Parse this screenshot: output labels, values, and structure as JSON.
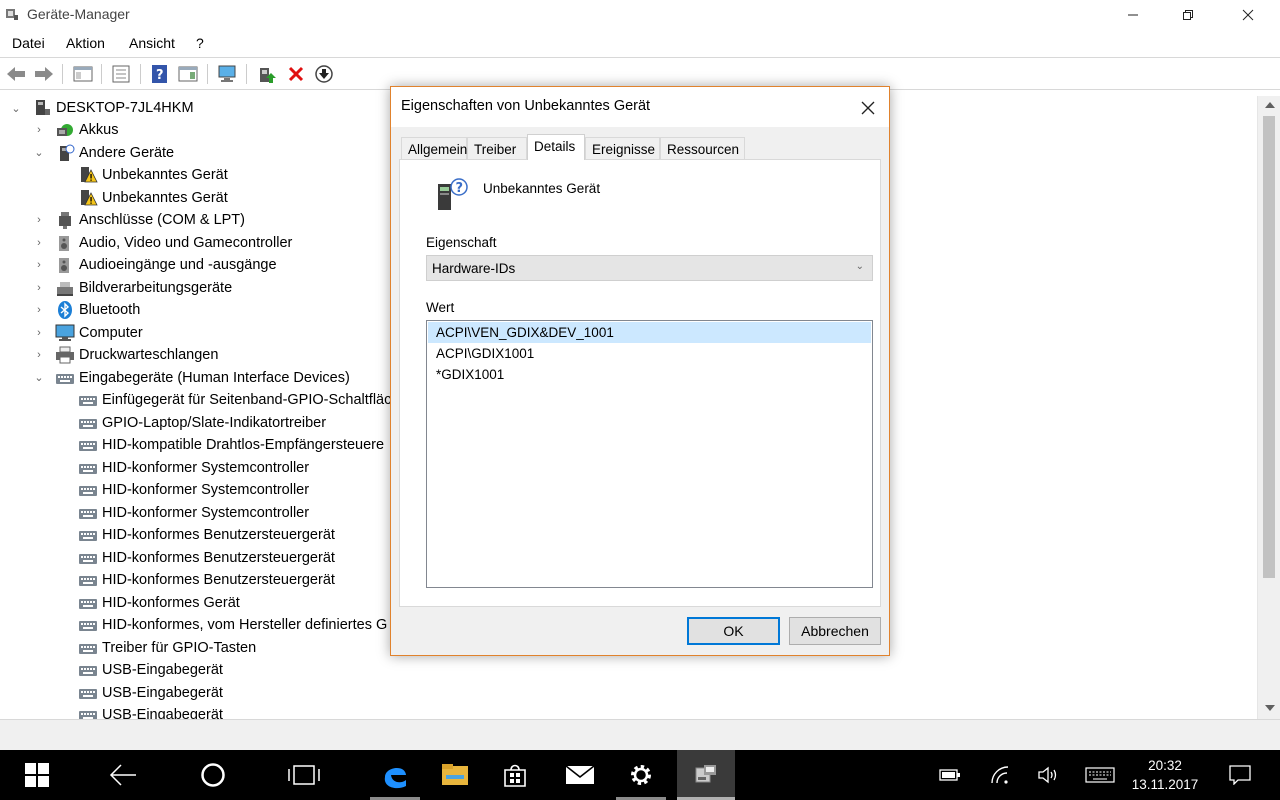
{
  "window": {
    "title": "Geräte-Manager"
  },
  "menu": [
    "Datei",
    "Aktion",
    "Ansicht",
    "?"
  ],
  "tree": {
    "root": "DESKTOP-7JL4HKM",
    "items": [
      {
        "label": "Akkus",
        "level": 1,
        "expander": "›",
        "icon": "battery-icon"
      },
      {
        "label": "Andere Geräte",
        "level": 1,
        "expander": "⌄",
        "icon": "other-devices-icon"
      },
      {
        "label": "Unbekanntes Gerät",
        "level": 2,
        "expander": "",
        "icon": "unknown-device-warning-icon"
      },
      {
        "label": "Unbekanntes Gerät",
        "level": 2,
        "expander": "",
        "icon": "unknown-device-warning-icon"
      },
      {
        "label": "Anschlüsse (COM & LPT)",
        "level": 1,
        "expander": "›",
        "icon": "port-icon"
      },
      {
        "label": "Audio, Video und Gamecontroller",
        "level": 1,
        "expander": "›",
        "icon": "speaker-icon"
      },
      {
        "label": "Audioeingänge und -ausgänge",
        "level": 1,
        "expander": "›",
        "icon": "speaker-icon"
      },
      {
        "label": "Bildverarbeitungsgeräte",
        "level": 1,
        "expander": "›",
        "icon": "scanner-icon"
      },
      {
        "label": "Bluetooth",
        "level": 1,
        "expander": "›",
        "icon": "bluetooth-icon"
      },
      {
        "label": "Computer",
        "level": 1,
        "expander": "›",
        "icon": "monitor-icon"
      },
      {
        "label": "Druckwarteschlangen",
        "level": 1,
        "expander": "›",
        "icon": "printer-icon"
      },
      {
        "label": "Eingabegeräte (Human Interface Devices)",
        "level": 1,
        "expander": "⌄",
        "icon": "hid-icon"
      },
      {
        "label": "Einfügegerät für Seitenband-GPIO-Schaltfläc",
        "level": 2,
        "expander": "",
        "icon": "hid-icon"
      },
      {
        "label": "GPIO-Laptop/Slate-Indikatortreiber",
        "level": 2,
        "expander": "",
        "icon": "hid-icon"
      },
      {
        "label": "HID-kompatible Drahtlos-Empfängersteuere",
        "level": 2,
        "expander": "",
        "icon": "hid-icon"
      },
      {
        "label": "HID-konformer Systemcontroller",
        "level": 2,
        "expander": "",
        "icon": "hid-icon"
      },
      {
        "label": "HID-konformer Systemcontroller",
        "level": 2,
        "expander": "",
        "icon": "hid-icon"
      },
      {
        "label": "HID-konformer Systemcontroller",
        "level": 2,
        "expander": "",
        "icon": "hid-icon"
      },
      {
        "label": "HID-konformes Benutzersteuergerät",
        "level": 2,
        "expander": "",
        "icon": "hid-icon"
      },
      {
        "label": "HID-konformes Benutzersteuergerät",
        "level": 2,
        "expander": "",
        "icon": "hid-icon"
      },
      {
        "label": "HID-konformes Benutzersteuergerät",
        "level": 2,
        "expander": "",
        "icon": "hid-icon"
      },
      {
        "label": "HID-konformes Gerät",
        "level": 2,
        "expander": "",
        "icon": "hid-icon"
      },
      {
        "label": "HID-konformes, vom Hersteller definiertes G",
        "level": 2,
        "expander": "",
        "icon": "hid-icon"
      },
      {
        "label": "Treiber für GPIO-Tasten",
        "level": 2,
        "expander": "",
        "icon": "hid-icon"
      },
      {
        "label": "USB-Eingabegerät",
        "level": 2,
        "expander": "",
        "icon": "hid-icon"
      },
      {
        "label": "USB-Eingabegerät",
        "level": 2,
        "expander": "",
        "icon": "hid-icon"
      },
      {
        "label": "USB-Eingabegerät",
        "level": 2,
        "expander": "",
        "icon": "hid-icon"
      }
    ]
  },
  "dialog": {
    "title": "Eigenschaften von Unbekanntes Gerät",
    "tabs": [
      "Allgemein",
      "Treiber",
      "Details",
      "Ereignisse",
      "Ressourcen"
    ],
    "active_tab": "Details",
    "device_name": "Unbekanntes Gerät",
    "property_label": "Eigenschaft",
    "property_value": "Hardware-IDs",
    "value_label": "Wert",
    "values": [
      "ACPI\\VEN_GDIX&DEV_1001",
      "ACPI\\GDIX1001",
      "*GDIX1001"
    ],
    "ok_label": "OK",
    "cancel_label": "Abbrechen",
    "accent_color": "#e0822d"
  },
  "taskbar": {
    "time": "20:32",
    "date": "13.11.2017",
    "items": [
      "start-icon",
      "back-icon",
      "cortana-icon",
      "task-view-icon",
      "edge-icon",
      "file-explorer-icon",
      "store-icon",
      "mail-icon",
      "settings-icon",
      "device-manager-icon"
    ],
    "tray": [
      "battery-icon",
      "wifi-icon",
      "volume-icon",
      "keyboard-icon",
      "notification-icon"
    ]
  }
}
